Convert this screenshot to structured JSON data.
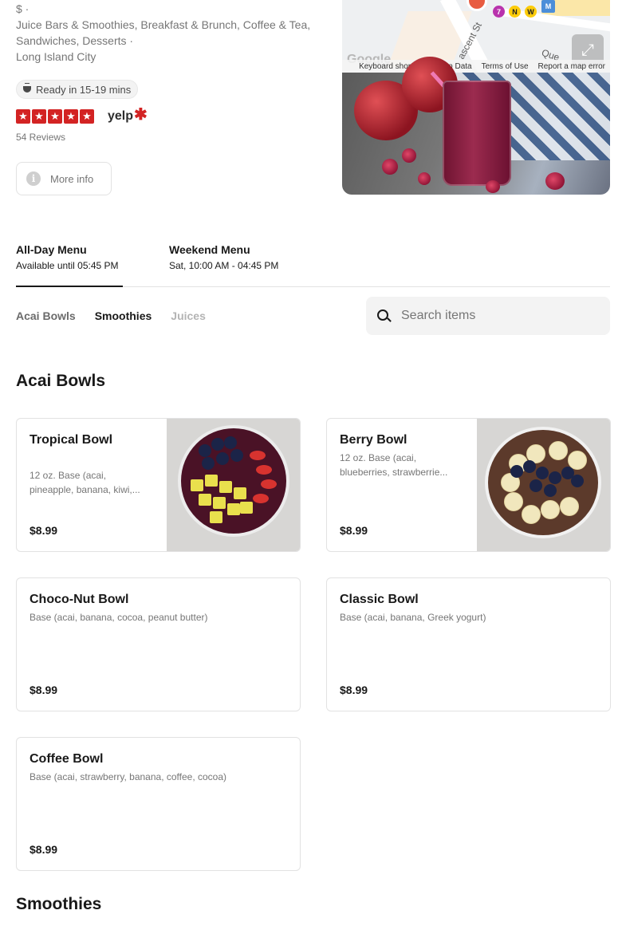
{
  "store": {
    "price_line": "$ ·",
    "categories": "Juice Bars & Smoothies, Breakfast & Brunch, Coffee & Tea, Sandwiches, Desserts ·",
    "neighborhood": "Long Island City",
    "ready_time": "Ready in 15-19 mins",
    "rating": 5,
    "rating_provider": "yelp",
    "reviews": "54 Reviews",
    "more_info_label": "More info"
  },
  "map": {
    "streets": [
      "ascent St",
      "Que"
    ],
    "lines": [
      "7",
      "N",
      "W",
      "M"
    ],
    "footer": [
      "Keyboard shortcuts",
      "Map Data",
      "Terms of Use",
      "Report a map error"
    ],
    "google_logo": "Google"
  },
  "menus": [
    {
      "title": "All-Day Menu",
      "subtitle": "Available until 05:45 PM",
      "active": true
    },
    {
      "title": "Weekend Menu",
      "subtitle": "Sat, 10:00 AM - 04:45 PM",
      "active": false
    }
  ],
  "category_nav": [
    "Acai Bowls",
    "Smoothies",
    "Juices"
  ],
  "search": {
    "placeholder": "Search items"
  },
  "sections": [
    {
      "title": "Acai Bowls",
      "items": [
        {
          "name": "Tropical Bowl",
          "description": "12 oz. Base (acai, pineapple, banana, kiwi,...",
          "price": "$8.99"
        },
        {
          "name": "Berry Bowl",
          "description": "12 oz. Base (acai, blueberries, strawberrie...",
          "price": "$8.99"
        },
        {
          "name": "Choco-Nut Bowl",
          "description": "Base (acai, banana, cocoa, peanut butter)",
          "price": "$8.99"
        },
        {
          "name": "Classic Bowl",
          "description": "Base (acai, banana, Greek yogurt)",
          "price": "$8.99"
        },
        {
          "name": "Coffee Bowl",
          "description": "Base (acai, strawberry, banana, coffee, cocoa)",
          "price": "$8.99"
        }
      ]
    },
    {
      "title": "Smoothies"
    }
  ],
  "colors": {
    "star_red": "#d32323",
    "text": "#191919",
    "muted": "#767676",
    "border": "#e2e2e2"
  },
  "icons": [
    "pot-icon",
    "star-icon",
    "yelp-logo",
    "info-icon",
    "expand-icon",
    "search-icon"
  ]
}
